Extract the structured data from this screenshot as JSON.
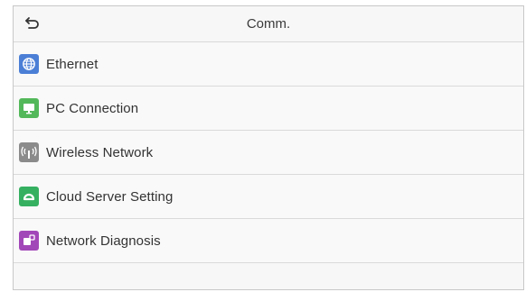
{
  "header": {
    "title": "Comm.",
    "back_icon": "back-arrow-icon"
  },
  "menu": {
    "items": [
      {
        "label": "Ethernet",
        "icon": "globe-icon",
        "color": "#4b7fd6"
      },
      {
        "label": "PC Connection",
        "icon": "monitor-icon",
        "color": "#53b85a"
      },
      {
        "label": "Wireless Network",
        "icon": "wireless-icon",
        "color": "#8b8b8b"
      },
      {
        "label": "Cloud Server Setting",
        "icon": "cloud-icon",
        "color": "#35b060"
      },
      {
        "label": "Network Diagnosis",
        "icon": "diagnosis-icon",
        "color": "#a247b8"
      }
    ]
  }
}
